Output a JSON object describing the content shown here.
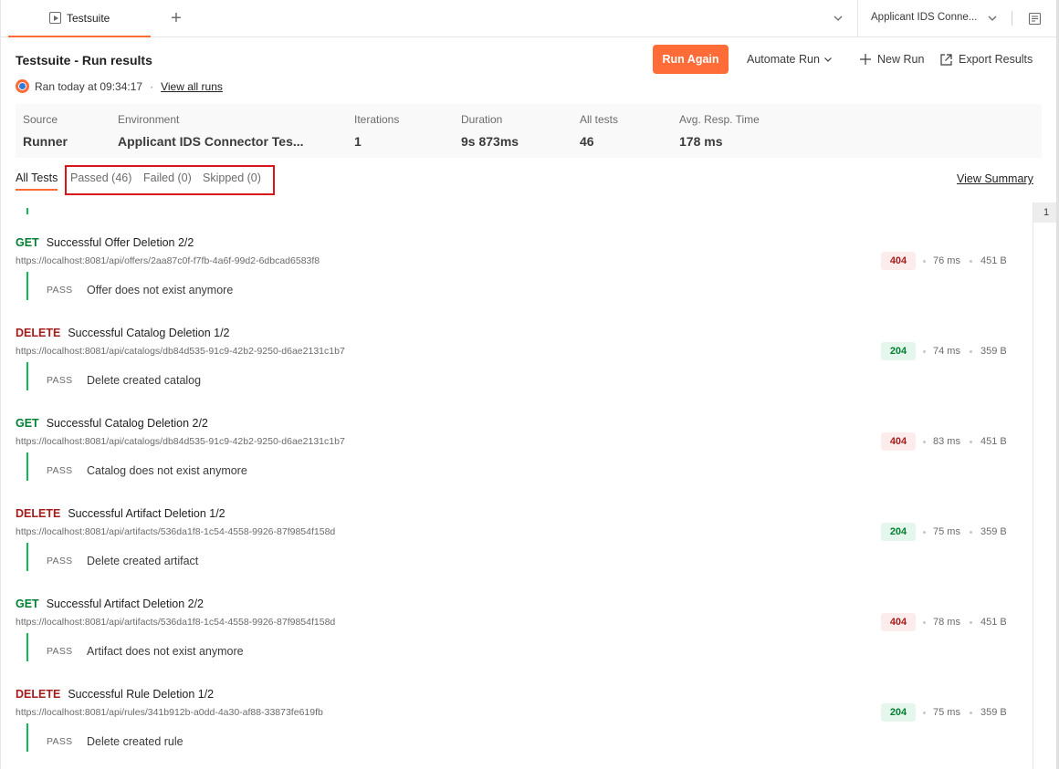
{
  "tabbar": {
    "active_tab": "Testsuite",
    "environment": "Applicant IDS Conne..."
  },
  "header": {
    "title": "Testsuite - Run results",
    "ran_at": "Ran today at 09:34:17",
    "separator": "·",
    "view_all_runs": "View all runs",
    "run_again": "Run Again",
    "automate_run": "Automate Run",
    "new_run": "New Run",
    "export_results": "Export Results"
  },
  "summary": {
    "source": {
      "label": "Source",
      "value": "Runner"
    },
    "environment": {
      "label": "Environment",
      "value": "Applicant IDS Connector Tes..."
    },
    "iterations": {
      "label": "Iterations",
      "value": "1"
    },
    "duration": {
      "label": "Duration",
      "value": "9s 873ms"
    },
    "all_tests": {
      "label": "All tests",
      "value": "46"
    },
    "avg_resp": {
      "label": "Avg. Resp. Time",
      "value": "178 ms"
    }
  },
  "filters": {
    "all": "All Tests",
    "passed": "Passed (46)",
    "failed": "Failed (0)",
    "skipped": "Skipped (0)",
    "view_summary": "View Summary"
  },
  "pager": {
    "page": "1"
  },
  "requests": [
    {
      "method": "GET",
      "name": "Successful Offer Deletion 2/2",
      "url": "https://localhost:8081/api/offers/2aa87c0f-f7fb-4a6f-99d2-6dbcad6583f8",
      "status": "404",
      "time": "76 ms",
      "size": "451 B",
      "result": "PASS",
      "test": "Offer does not exist anymore"
    },
    {
      "method": "DELETE",
      "name": "Successful Catalog Deletion 1/2",
      "url": "https://localhost:8081/api/catalogs/db84d535-91c9-42b2-9250-d6ae2131c1b7",
      "status": "204",
      "time": "74 ms",
      "size": "359 B",
      "result": "PASS",
      "test": "Delete created catalog"
    },
    {
      "method": "GET",
      "name": "Successful Catalog Deletion 2/2",
      "url": "https://localhost:8081/api/catalogs/db84d535-91c9-42b2-9250-d6ae2131c1b7",
      "status": "404",
      "time": "83 ms",
      "size": "451 B",
      "result": "PASS",
      "test": "Catalog does not exist anymore"
    },
    {
      "method": "DELETE",
      "name": "Successful Artifact Deletion 1/2",
      "url": "https://localhost:8081/api/artifacts/536da1f8-1c54-4558-9926-87f9854f158d",
      "status": "204",
      "time": "75 ms",
      "size": "359 B",
      "result": "PASS",
      "test": "Delete created artifact"
    },
    {
      "method": "GET",
      "name": "Successful Artifact Deletion 2/2",
      "url": "https://localhost:8081/api/artifacts/536da1f8-1c54-4558-9926-87f9854f158d",
      "status": "404",
      "time": "78 ms",
      "size": "451 B",
      "result": "PASS",
      "test": "Artifact does not exist anymore"
    },
    {
      "method": "DELETE",
      "name": "Successful Rule Deletion 1/2",
      "url": "https://localhost:8081/api/rules/341b912b-a0dd-4a30-af88-33873fe619fb",
      "status": "204",
      "time": "75 ms",
      "size": "359 B",
      "result": "PASS",
      "test": "Delete created rule"
    }
  ],
  "colors": {
    "accent": "#ff6c37",
    "get": "#007f31",
    "delete": "#a61c1c",
    "pass_bar": "#0cbb52",
    "highlight": "#d9161a"
  }
}
